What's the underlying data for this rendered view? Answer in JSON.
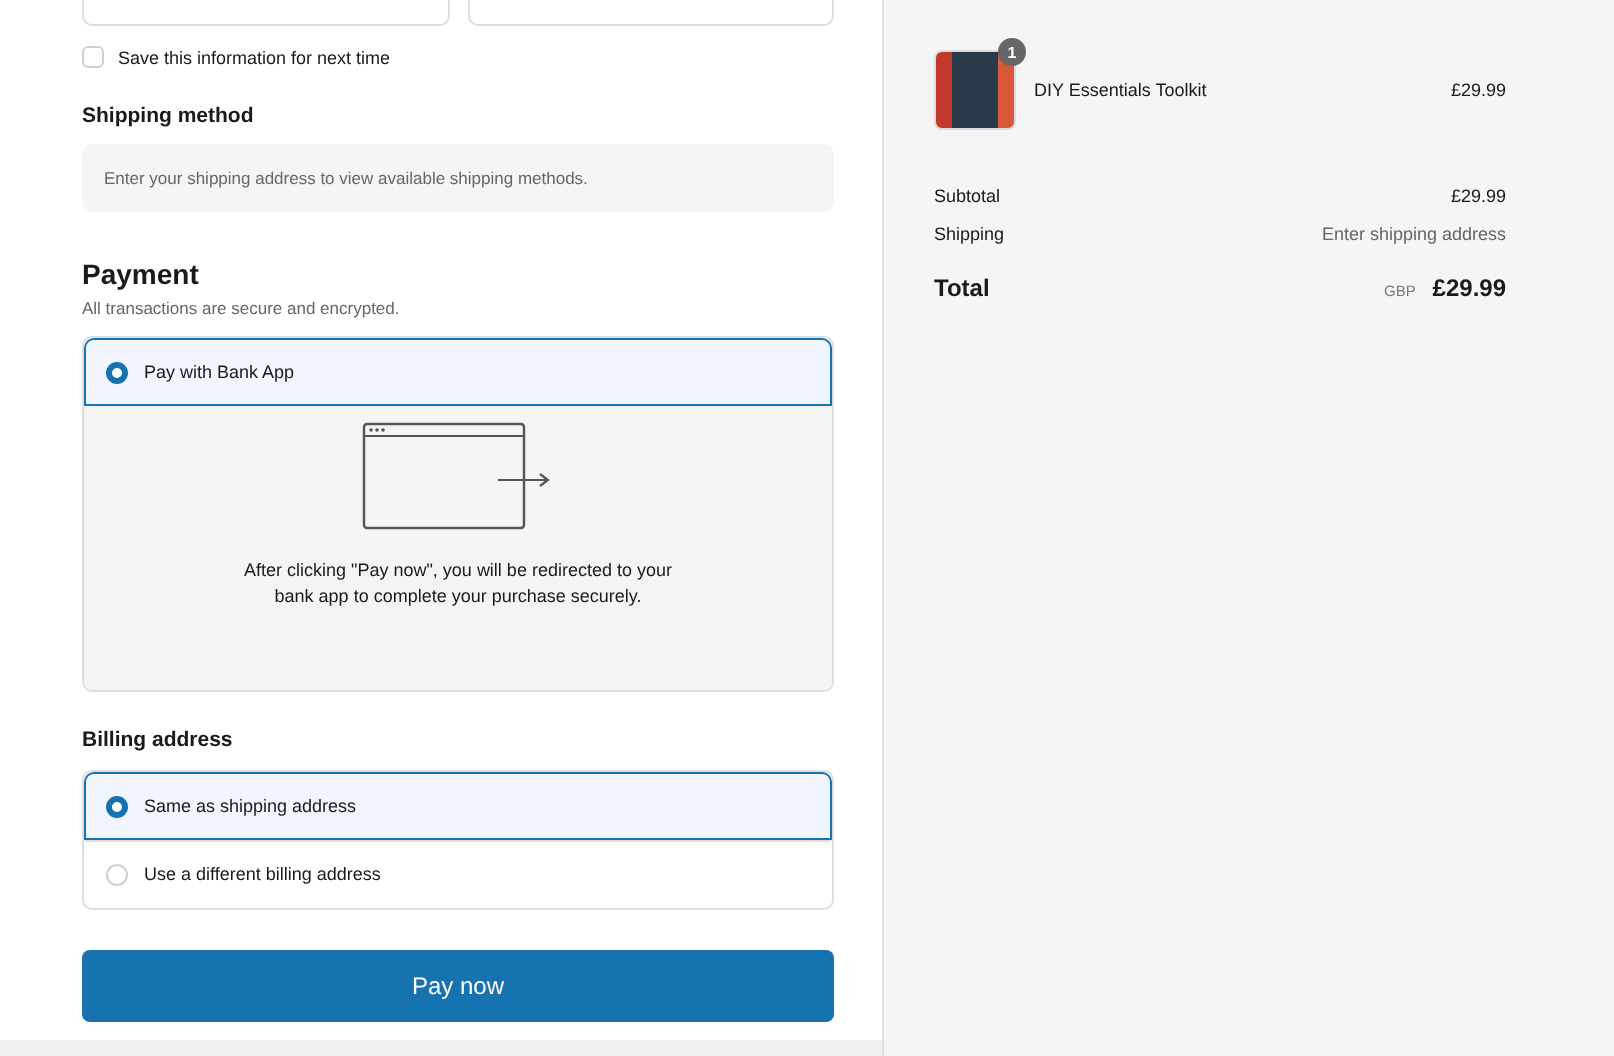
{
  "save_info": {
    "label": "Save this information for next time",
    "checked": false
  },
  "shipping_method": {
    "title": "Shipping method",
    "notice": "Enter your shipping address to view available shipping methods."
  },
  "payment": {
    "title": "Payment",
    "subtitle": "All transactions are secure and encrypted.",
    "options": [
      {
        "label": "Pay with Bank App",
        "selected": true,
        "description": "After clicking \"Pay now\", you will be redirected to your bank app to complete your purchase securely."
      }
    ]
  },
  "billing": {
    "title": "Billing address",
    "options": [
      {
        "label": "Same as shipping address",
        "selected": true
      },
      {
        "label": "Use a different billing address",
        "selected": false
      }
    ]
  },
  "pay_button": "Pay now",
  "summary": {
    "items": [
      {
        "quantity": "1",
        "title": "DIY Essentials Toolkit",
        "price": "£29.99"
      }
    ],
    "rows": [
      {
        "label": "Subtotal",
        "value": "£29.99",
        "kind": "amount"
      },
      {
        "label": "Shipping",
        "value": "Enter shipping address",
        "kind": "note"
      }
    ],
    "total": {
      "label": "Total",
      "currency": "GBP",
      "value": "£29.99"
    }
  }
}
